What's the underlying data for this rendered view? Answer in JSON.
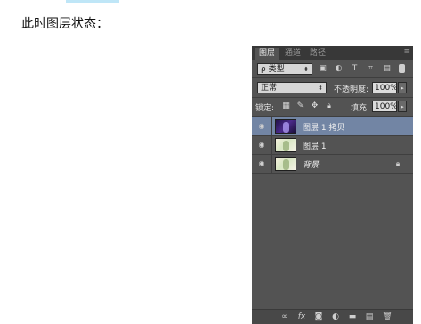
{
  "caption": "此时图层状态：",
  "panel": {
    "tabs": [
      "图层",
      "通道",
      "路径"
    ],
    "active_tab": "图层",
    "menu_icon": "panel-menu-icon",
    "filter": {
      "label": "ρ 类型",
      "icons": [
        "image-filter-icon",
        "adjustment-filter-icon",
        "text-filter-icon",
        "shape-filter-icon",
        "smart-object-filter-icon"
      ]
    },
    "blend_mode": "正常",
    "opacity_label": "不透明度:",
    "opacity_value": "100%",
    "lock_label": "锁定:",
    "lock_icons": [
      "lock-transparent-icon",
      "lock-image-icon",
      "lock-position-icon",
      "lock-all-icon"
    ],
    "fill_label": "填充:",
    "fill_value": "100%",
    "layers": [
      {
        "name": "图层 1 拷贝",
        "selected": true,
        "visible": true,
        "thumbnail": "purple"
      },
      {
        "name": "图层 1",
        "selected": false,
        "visible": true,
        "thumbnail": "light"
      },
      {
        "name": "背景",
        "selected": false,
        "visible": true,
        "thumbnail": "light",
        "locked": true,
        "italic": true
      }
    ],
    "bottom_icons": [
      "link-layers-icon",
      "fx-icon",
      "add-mask-icon",
      "adjustment-layer-icon",
      "new-group-icon",
      "new-layer-icon",
      "delete-layer-icon"
    ],
    "colors": {
      "panel_bg": "#535353",
      "selected_row": "#7285a4",
      "tab_bar": "#383838"
    }
  }
}
